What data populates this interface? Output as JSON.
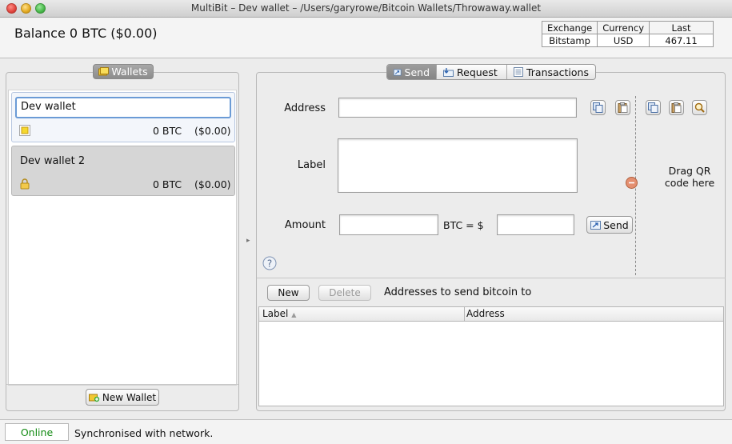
{
  "window": {
    "title": "MultiBit – Dev wallet – /Users/garyrowe/Bitcoin Wallets/Throwaway.wallet"
  },
  "header": {
    "balance": "Balance 0 BTC  ($0.00)"
  },
  "exchange_table": {
    "headers": [
      "Exchange",
      "Currency",
      "Last"
    ],
    "row": [
      "Bitstamp",
      "USD",
      "467.11"
    ]
  },
  "wallets_panel": {
    "tab_label": "Wallets",
    "wallets": [
      {
        "name": "Dev wallet",
        "btc": "0 BTC",
        "fiat": "($0.00)",
        "icon": "wallet-unlocked-icon",
        "selected": true
      },
      {
        "name": "Dev wallet 2",
        "btc": "0 BTC",
        "fiat": "($0.00)",
        "icon": "padlock-icon",
        "selected": false
      }
    ],
    "new_wallet_label": "New Wallet"
  },
  "tabs": [
    {
      "label": "Send",
      "icon": "send-icon",
      "active": true
    },
    {
      "label": "Request",
      "icon": "request-icon",
      "active": false
    },
    {
      "label": "Transactions",
      "icon": "transactions-icon",
      "active": false
    }
  ],
  "send_form": {
    "address_label": "Address",
    "address_value": "",
    "label_label": "Label",
    "label_value": "",
    "amount_label": "Amount",
    "btc_value": "",
    "btc_equals": "BTC  =  $",
    "usd_value": "",
    "send_button": "Send",
    "qr_drop_text": "Drag QR code here",
    "tool_icons": [
      "copy-icon",
      "paste-icon",
      "copy-icon",
      "paste-icon",
      "zoom-icon"
    ]
  },
  "address_book": {
    "new_button": "New",
    "delete_button": "Delete",
    "caption": "Addresses to send bitcoin to",
    "columns": [
      "Label",
      "Address"
    ],
    "rows": []
  },
  "status": {
    "online": "Online",
    "message": "Synchronised with network."
  },
  "colors": {
    "online_green": "#118a11",
    "selection_blue": "#6b9bd6"
  }
}
